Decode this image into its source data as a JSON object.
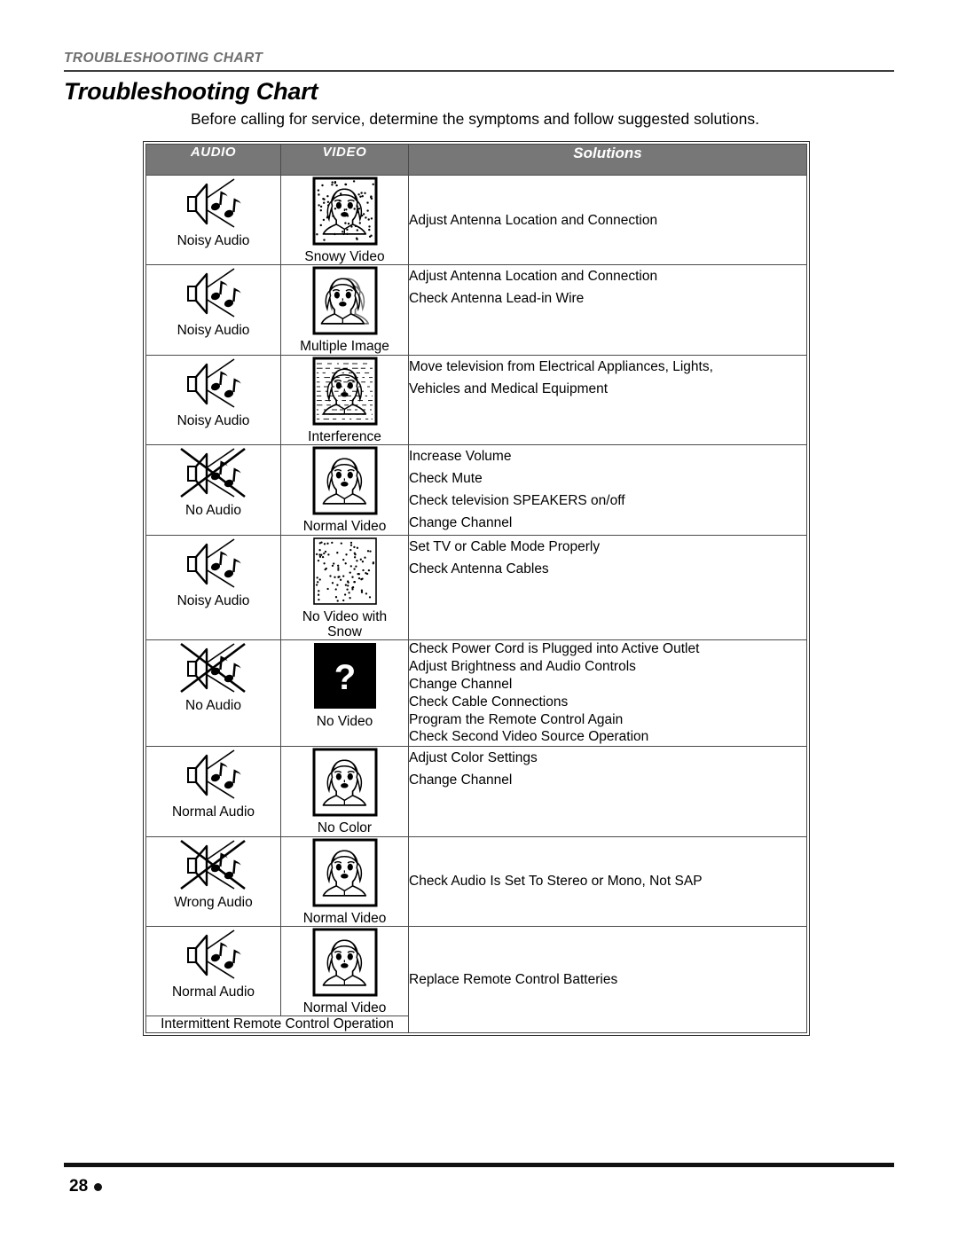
{
  "running_head": "Troubleshooting Chart",
  "page_title": "Troubleshooting Chart",
  "intro": "Before calling for service, determine the symptoms and follow suggested solutions.",
  "table": {
    "headers": {
      "audio": "Audio",
      "video": "Video",
      "solutions": "Solutions"
    },
    "rows": [
      {
        "audio_label": "Noisy Audio",
        "audio_icon": "noisy-audio-icon",
        "video_label": "Snowy Video",
        "video_icon": "snowy-video-icon",
        "solutions": [
          "Adjust Antenna Location and Connection"
        ]
      },
      {
        "audio_label": "Noisy Audio",
        "audio_icon": "noisy-audio-icon",
        "video_label": "Multiple Image",
        "video_icon": "multiple-image-icon",
        "solutions": [
          "Adjust Antenna Location and Connection",
          "Check Antenna Lead-in Wire"
        ]
      },
      {
        "audio_label": "Noisy Audio",
        "audio_icon": "noisy-audio-icon",
        "video_label": "Interference",
        "video_icon": "interference-icon",
        "solutions": [
          "Move television from Electrical Appliances, Lights,",
          "Vehicles and Medical Equipment"
        ]
      },
      {
        "audio_label": "No Audio",
        "audio_icon": "no-audio-icon",
        "video_label": "Normal Video",
        "video_icon": "normal-video-icon",
        "solutions": [
          "Increase Volume",
          "Check Mute",
          "Check television SPEAKERS on/off",
          "Change Channel"
        ]
      },
      {
        "audio_label": "Noisy Audio",
        "audio_icon": "noisy-audio-icon",
        "video_label": "No Video with\nSnow",
        "video_icon": "no-video-with-snow-icon",
        "solutions": [
          "Set TV or Cable Mode Properly",
          "Check Antenna Cables"
        ]
      },
      {
        "audio_label": "No Audio",
        "audio_icon": "no-audio-icon",
        "video_label": "No Video",
        "video_icon": "no-video-icon",
        "solutions": [
          "Check Power Cord is Plugged into Active Outlet",
          "Adjust Brightness and Audio Controls",
          "Change Channel",
          "Check Cable Connections",
          "Program the Remote Control Again",
          "Check Second Video Source Operation"
        ]
      },
      {
        "audio_label": "Normal Audio",
        "audio_icon": "normal-audio-icon",
        "video_label": "No Color",
        "video_icon": "no-color-icon",
        "solutions": [
          "Adjust Color Settings",
          "Change Channel"
        ]
      },
      {
        "audio_label": "Wrong Audio",
        "audio_icon": "wrong-audio-icon",
        "video_label": "Normal Video",
        "video_icon": "normal-video-icon",
        "solutions": [
          "Check Audio Is Set To Stereo or Mono, Not SAP"
        ]
      },
      {
        "audio_label": "Normal Audio",
        "audio_icon": "normal-audio-icon",
        "video_label": "Normal Video",
        "video_icon": "normal-video-icon",
        "solutions": [
          "Replace Remote Control Batteries"
        ],
        "span_note": "Intermittent Remote Control Operation"
      }
    ]
  },
  "footer": {
    "page_number": "28"
  },
  "colors": {
    "header_bg": "#777777",
    "header_text": "#ffffff",
    "running_head_text": "#6f6f6f",
    "rule": "#2b2b2b"
  }
}
